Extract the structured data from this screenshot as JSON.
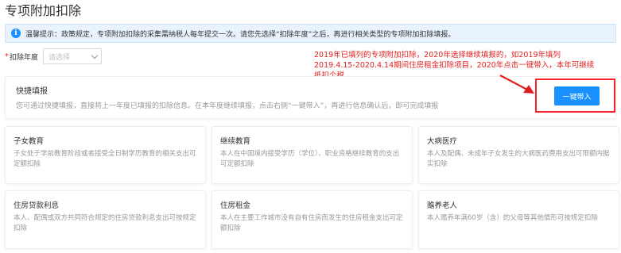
{
  "page": {
    "title": "专项附加扣除"
  },
  "notice": {
    "text": "温馨提示：政策规定，专项附加扣除的采集需纳税人每年提交一次。请您先选择“扣除年度”之后，再进行相关类型的专项附加扣除填报。"
  },
  "year_select": {
    "required_mark": "*",
    "label": "扣除年度",
    "placeholder": "请选择"
  },
  "annotation": {
    "text": "2019年已填列的专项附加扣除，2020年选择继续填报的，如2019年填列2019.4.15-2020.4.14期间住房租金扣除项目，2020年点击一键带入，本年可继续抵扣个税"
  },
  "quick_fill": {
    "title": "快捷填报",
    "description": "您可通过快捷填报，直接将上一年度已填报的扣除信息。在本年度继续填报，点击右侧“一键带入”，再进行信息确认后，即可完成填报",
    "button_label": "一键带入"
  },
  "colors": {
    "primary": "#1890ff",
    "annotation_red": "#e02020"
  },
  "categories": [
    {
      "title": "子女教育",
      "description": "子女处于学前教育阶段或者接受全日制学历教育的相关支出可定额扣除"
    },
    {
      "title": "继续教育",
      "description": "本人在中国境内接受学历（学位）、职业资格继续教育的支出可定额扣除"
    },
    {
      "title": "大病医疗",
      "description": "本人及配偶、未成年子女发生的大病医药费用支出可限额内据实扣除"
    },
    {
      "title": "住房贷款利息",
      "description": "本人、配偶或双方共同符合规定的住房贷款利息支出可按规定扣除"
    },
    {
      "title": "住房租金",
      "description": "本人在主要工作城市没有自有住房而发生的住房租金支出可定额扣除"
    },
    {
      "title": "赡养老人",
      "description": "本人赡养年满60岁（含）的父母等其他情形可按规定扣除"
    }
  ]
}
